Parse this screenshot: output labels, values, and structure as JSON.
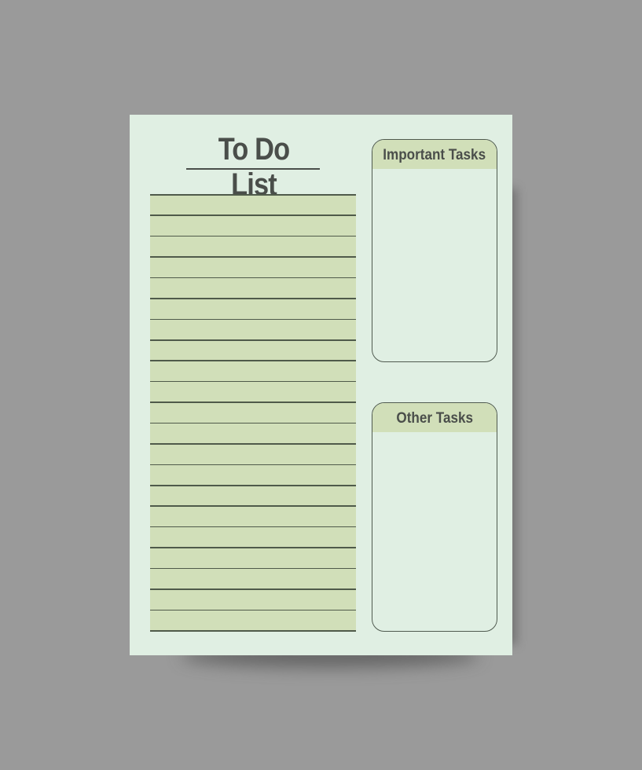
{
  "planner": {
    "title": "To Do List",
    "line_count": 22,
    "sections": [
      {
        "label": "Important Tasks"
      },
      {
        "label": "Other Tasks"
      }
    ],
    "colors": {
      "background": "#9a9a9a",
      "paper": "#e0efe3",
      "accent": "#d1dfb9",
      "text": "#4a4e4a",
      "rule": "#4f5a4a"
    }
  }
}
